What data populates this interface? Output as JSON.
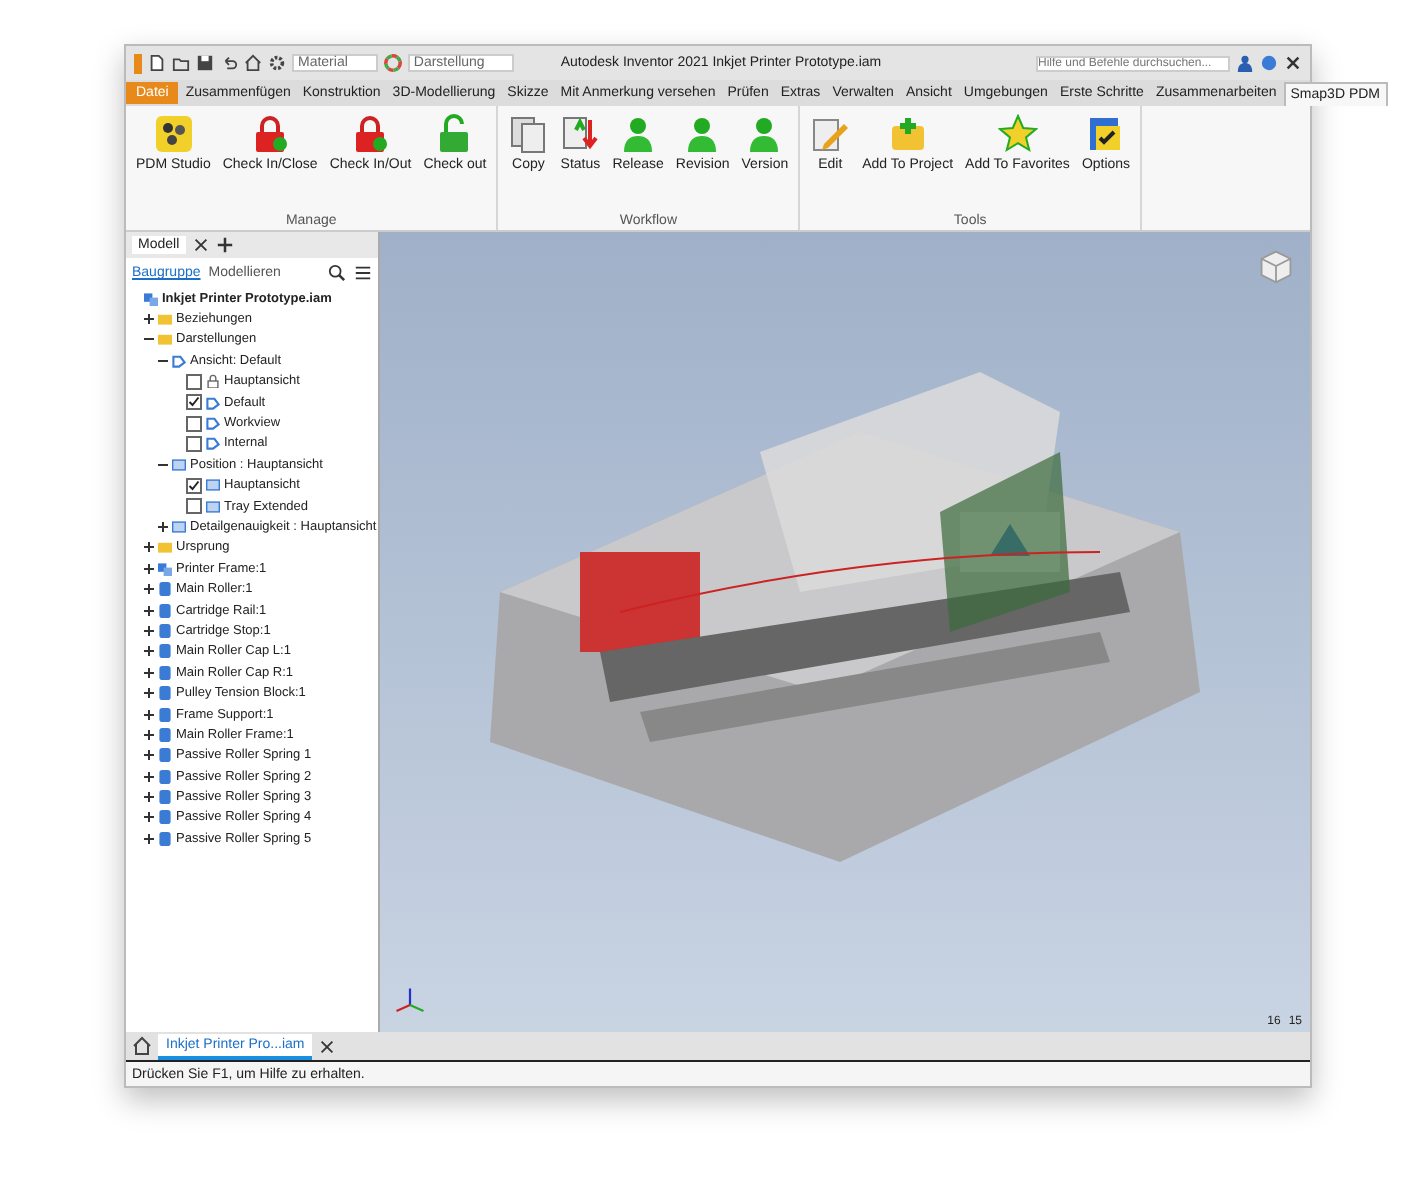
{
  "quick_access": {
    "material": "Material",
    "appearance": "Darstellung"
  },
  "title": {
    "app": "Autodesk Inventor 2021",
    "document": "Inkjet Printer Prototype.iam"
  },
  "search": {
    "placeholder": "Hilfe und Befehle durchsuchen..."
  },
  "file_menu": "Datei",
  "ribbon_tabs": [
    {
      "label": "Zusammenfügen",
      "selected": false,
      "kind": "tab"
    },
    {
      "label": "Konstruktion",
      "selected": false,
      "kind": "tab"
    },
    {
      "label": "3D-Modellierung",
      "selected": false,
      "kind": "tab"
    },
    {
      "label": "Skizze",
      "selected": false,
      "kind": "tab"
    },
    {
      "label": "Mit Anmerkung versehen",
      "selected": false,
      "kind": "tab"
    },
    {
      "label": "Prüfen",
      "selected": false,
      "kind": "tab"
    },
    {
      "label": "Extras",
      "selected": false,
      "kind": "tab"
    },
    {
      "label": "Verwalten",
      "selected": false,
      "kind": "tab"
    },
    {
      "label": "Ansicht",
      "selected": false,
      "kind": "tab"
    },
    {
      "label": "Umgebungen",
      "selected": false,
      "kind": "tab"
    },
    {
      "label": "Erste Schritte",
      "selected": false,
      "kind": "tab"
    },
    {
      "label": "Zusammenarbeiten",
      "selected": false,
      "kind": "tab"
    },
    {
      "label": "Smap3D PDM",
      "selected": true,
      "kind": "tab"
    }
  ],
  "ribbon_groups": [
    {
      "title": "Manage",
      "buttons": [
        {
          "label": "PDM Studio",
          "kind": "badge"
        },
        {
          "label": "Check In/Close",
          "kind": "lock"
        },
        {
          "label": "Check In/Out",
          "kind": "lock"
        },
        {
          "label": "Check out",
          "kind": "unlock"
        }
      ]
    },
    {
      "title": "Workflow",
      "buttons": [
        {
          "label": "Copy",
          "kind": "pages"
        },
        {
          "label": "Status",
          "kind": "arrows"
        },
        {
          "label": "Release",
          "kind": "person"
        },
        {
          "label": "Revision",
          "kind": "person"
        },
        {
          "label": "Version",
          "kind": "person"
        }
      ]
    },
    {
      "title": "Tools",
      "buttons": [
        {
          "label": "Edit",
          "kind": "pencil"
        },
        {
          "label": "Add To Project",
          "kind": "plus"
        },
        {
          "label": "Add To Favorites",
          "kind": "star"
        },
        {
          "label": "Options",
          "kind": "checklist"
        }
      ]
    }
  ],
  "browser": {
    "tabs": [
      {
        "label": "Modell",
        "selected": true
      }
    ],
    "modes": [
      {
        "label": "Baugruppe",
        "selected": true
      },
      {
        "label": "Modellieren",
        "selected": false
      }
    ],
    "tree": {
      "label": "Inkjet Printer Prototype.iam",
      "kind": "assembly",
      "children": [
        {
          "label": "Beziehungen",
          "kind": "folder",
          "expanded": false
        },
        {
          "label": "Darstellungen",
          "kind": "folder",
          "expanded": true,
          "children": [
            {
              "label": "Ansicht: Default",
              "kind": "view",
              "expanded": true,
              "children": [
                {
                  "label": "Hauptansicht",
                  "kind": "lock",
                  "checked": false
                },
                {
                  "label": "Default",
                  "kind": "view",
                  "checked": true
                },
                {
                  "label": "Workview",
                  "kind": "view",
                  "checked": false
                },
                {
                  "label": "Internal",
                  "kind": "view",
                  "checked": false
                }
              ]
            },
            {
              "label": "Position : Hauptansicht",
              "kind": "position",
              "expanded": true,
              "children": [
                {
                  "label": "Hauptansicht",
                  "kind": "position",
                  "checked": true
                },
                {
                  "label": "Tray Extended",
                  "kind": "position",
                  "checked": false
                }
              ]
            },
            {
              "label": "Detailgenauigkeit : Hauptansicht",
              "kind": "position",
              "expanded": false
            }
          ]
        },
        {
          "label": "Ursprung",
          "kind": "folder",
          "expanded": false
        },
        {
          "label": "Printer Frame:1",
          "kind": "assembly",
          "expanded": false
        },
        {
          "label": "Main Roller:1",
          "kind": "part",
          "expanded": false
        },
        {
          "label": "Cartridge Rail:1",
          "kind": "part",
          "expanded": false
        },
        {
          "label": "Cartridge Stop:1",
          "kind": "part",
          "expanded": false
        },
        {
          "label": "Main Roller Cap L:1",
          "kind": "part",
          "expanded": false
        },
        {
          "label": "Main Roller Cap R:1",
          "kind": "part",
          "expanded": false
        },
        {
          "label": "Pulley Tension Block:1",
          "kind": "part",
          "expanded": false
        },
        {
          "label": "Frame Support:1",
          "kind": "part",
          "expanded": false
        },
        {
          "label": "Main Roller Frame:1",
          "kind": "part",
          "expanded": false
        },
        {
          "label": "Passive Roller Spring 1",
          "kind": "part",
          "expanded": false
        },
        {
          "label": "Passive Roller Spring 2",
          "kind": "part",
          "expanded": false
        },
        {
          "label": "Passive Roller Spring 3",
          "kind": "part",
          "expanded": false
        },
        {
          "label": "Passive Roller Spring 4",
          "kind": "part",
          "expanded": false
        },
        {
          "label": "Passive Roller Spring 5",
          "kind": "part",
          "expanded": false
        }
      ]
    }
  },
  "viewport": {
    "counts": [
      "16",
      "15"
    ]
  },
  "document_tabs": [
    {
      "label": "Inkjet Printer Pro...iam",
      "selected": true
    }
  ],
  "status_bar": "Drücken Sie F1, um Hilfe zu erhalten."
}
